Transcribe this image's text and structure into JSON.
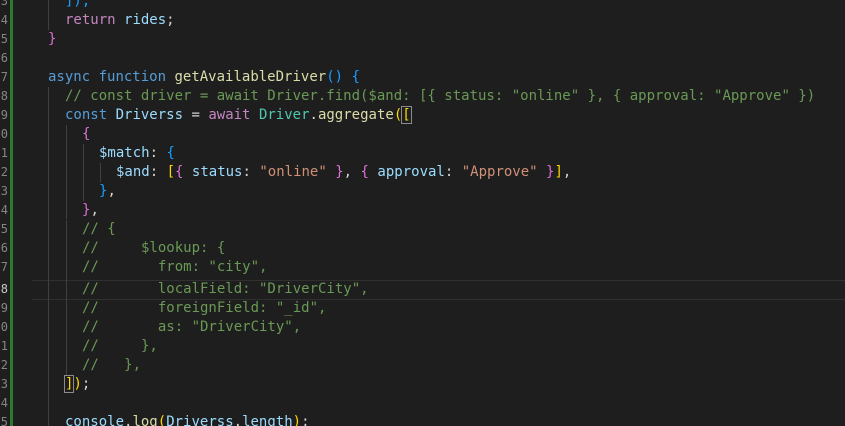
{
  "gutter": {
    "line_numbers": [
      "3",
      "4",
      "5",
      "6",
      "7",
      "8",
      "9",
      "0",
      "1",
      "2",
      "3",
      "4",
      "5",
      "6",
      "7",
      "8",
      "9",
      "0",
      "1",
      "2",
      "3",
      "4",
      "5"
    ],
    "active_index": 15
  },
  "code": {
    "l0": {
      "a": "]);"
    },
    "l1": {
      "kw": "return",
      "v": "rides",
      "p": ";"
    },
    "l2": {
      "b": "}"
    },
    "l4": {
      "kw": "async",
      "kw2": "function",
      "fn": "getAvailableDriver",
      "bo": "(",
      "bc": ")",
      "b": "{"
    },
    "l5": {
      "cm": "// const driver = await Driver.find($and: [{ status: \"online\" }, { approval: \"Approve\" })"
    },
    "l6": {
      "kw": "const",
      "v": "Driverss",
      "eq": "=",
      "ctl": "await",
      "cls": "Driver",
      "dot": ".",
      "fn": "aggregate",
      "bo": "(",
      "bk": "["
    },
    "l7": {
      "b": "{"
    },
    "l8": {
      "k": "$match",
      "c": ":",
      "b": "{"
    },
    "l9": {
      "k": "$and",
      "c": ":",
      "bk": "[",
      "bo": "{",
      "k2": "status",
      "c2": ":",
      "s": "\"online\"",
      "bc": "}",
      "cm": ",",
      "bo2": "{",
      "k3": "approval",
      "c3": ":",
      "s2": "\"Approve\"",
      "bc2": "}",
      "bkc": "]",
      "end": ","
    },
    "l10": {
      "b": "}",
      "p": ","
    },
    "l11": {
      "b": "}",
      "p": ","
    },
    "l12": {
      "cm": "// {"
    },
    "l13": {
      "cm": "//     $lookup: {"
    },
    "l14": {
      "cm": "//       from: \"city\","
    },
    "l15": {
      "cm": "//       localField: \"DriverCity\","
    },
    "l16": {
      "cm": "//       foreignField: \"_id\","
    },
    "l17": {
      "cm": "//       as: \"DriverCity\","
    },
    "l18": {
      "cm": "//     },"
    },
    "l19": {
      "cm": "//   },"
    },
    "l20": {
      "bk": "]",
      "bc": ")",
      "p": ";"
    },
    "l22": {
      "obj": "console",
      "dot": ".",
      "fn": "log",
      "bo": "(",
      "v": "Driverss",
      "dot2": ".",
      "prop": "length",
      "bc": ")",
      "p": ";"
    }
  },
  "colors": {
    "background": "#1e1e1e",
    "keyword": "#569cd6",
    "control": "#c586c0",
    "function": "#dcdcaa",
    "variable": "#9cdcfe",
    "class": "#4ec9b0",
    "string": "#ce9178",
    "comment": "#6a9955",
    "git_added": "#2c7a2c"
  }
}
